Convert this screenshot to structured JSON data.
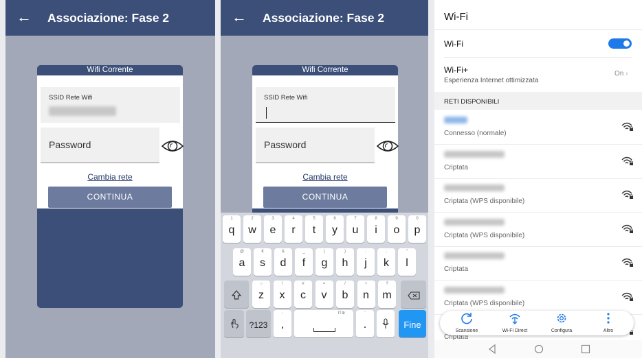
{
  "screen1": {
    "back_icon": "arrow-left-icon",
    "title": "Associazione: Fase 2",
    "card_title": "Wifi Corrente",
    "ssid_label": "SSID Rete Wifi",
    "password_label": "Password",
    "eye_icon": "eye-icon",
    "change_network": "Cambia rete",
    "continue_label": "CONTINUA"
  },
  "screen2": {
    "back_icon": "arrow-left-icon",
    "title": "Associazione: Fase 2",
    "card_title": "Wifi Corrente",
    "ssid_label": "SSID Rete Wifi",
    "password_label": "Password",
    "eye_icon": "eye-icon",
    "change_network": "Cambia rete",
    "continue_label": "CONTINUA",
    "keyboard": {
      "row1": [
        {
          "k": "q",
          "h": "1"
        },
        {
          "k": "w",
          "h": "2"
        },
        {
          "k": "e",
          "h": "3"
        },
        {
          "k": "r",
          "h": "4"
        },
        {
          "k": "t",
          "h": "5"
        },
        {
          "k": "y",
          "h": "6"
        },
        {
          "k": "u",
          "h": "7"
        },
        {
          "k": "i",
          "h": "8"
        },
        {
          "k": "o",
          "h": "9"
        },
        {
          "k": "p",
          "h": "0"
        }
      ],
      "row2": [
        {
          "k": "a",
          "h": "@"
        },
        {
          "k": "s",
          "h": "€"
        },
        {
          "k": "d",
          "h": "&"
        },
        {
          "k": "f",
          "h": "_"
        },
        {
          "k": "g",
          "h": "("
        },
        {
          "k": "h",
          "h": ")"
        },
        {
          "k": "j",
          "h": ":"
        },
        {
          "k": "k",
          "h": ";"
        },
        {
          "k": "l",
          "h": "\""
        }
      ],
      "row3": [
        {
          "k": "z",
          "h": "○"
        },
        {
          "k": "x",
          "h": "!"
        },
        {
          "k": "c",
          "h": "#"
        },
        {
          "k": "v",
          "h": "="
        },
        {
          "k": "b",
          "h": "/"
        },
        {
          "k": "n",
          "h": "+"
        },
        {
          "k": "m",
          "h": "?"
        }
      ],
      "shift_icon": "shift-icon",
      "backspace_icon": "backspace-icon",
      "gesture_icon": "gesture-icon",
      "sym_label": "?123",
      "comma": ",",
      "comma_hint": "-",
      "space_hint": "IT⊕",
      "period": ".",
      "period_hint": "'",
      "mic_icon": "microphone-icon",
      "done_label": "Fine"
    }
  },
  "screen3": {
    "title": "Wi-Fi",
    "wifi_label": "Wi-Fi",
    "wifi_toggle": "on",
    "wifi_plus_title": "Wi-Fi+",
    "wifi_plus_subtitle": "Esperienza Internet ottimizzata",
    "wifi_plus_status": "On",
    "section_header": "RETI DISPONIBILI",
    "networks": [
      {
        "status": "Connesso (normale)"
      },
      {
        "status": "Criptata"
      },
      {
        "status": "Criptata (WPS disponibile)"
      },
      {
        "status": "Criptata (WPS disponibile)"
      },
      {
        "status": "Criptata"
      },
      {
        "status": "Criptata (WPS disponibile)"
      },
      {
        "status": "Criptata"
      }
    ],
    "bottom_actions": {
      "scan": "Scansione",
      "direct": "Wi-Fi Direct",
      "configure": "Configura",
      "more": "Altro"
    },
    "accent": "#1e7ae8"
  },
  "colors": {
    "app_bar": "#3b4f79",
    "dim_background": "#a3a8b8",
    "button": "#6d7b9e",
    "keyboard_done": "#2196f3"
  }
}
